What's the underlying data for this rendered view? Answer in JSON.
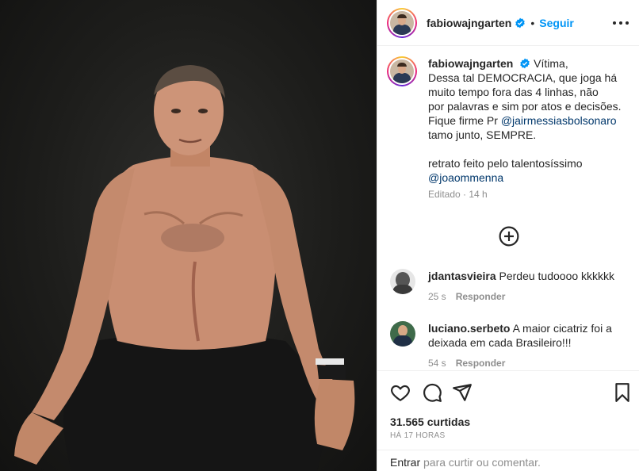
{
  "post": {
    "author": "fabiowajngarten",
    "follow_label": "Seguir",
    "dot": "•",
    "caption_lines": [
      "Vítima,",
      "Dessa tal DEMOCRACIA, que joga há",
      "muito tempo fora das 4 linhas, não",
      "por palavras e sim por atos e decisões.",
      "Fique firme Pr ",
      "tamo junto, SEMPRE.",
      "retrato feito pelo talentosíssimo"
    ],
    "mention_1": "@jairmessiasbolsonaro",
    "mention_2": "@joaommenna",
    "caption_meta": "Editado · 14 h"
  },
  "comments": [
    {
      "user": "jdantasvieira",
      "text": "Perdeu tudoooo kkkkkk",
      "time": "25 s",
      "reply": "Responder"
    },
    {
      "user": "luciano.serbeto",
      "text_line1": "A maior cicatriz foi a",
      "text_line2": "deixada em cada Brasileiro!!!",
      "time": "54 s",
      "reply": "Responder"
    }
  ],
  "actions": {
    "likes": "31.565 curtidas",
    "when": "HÁ 17 HORAS"
  },
  "footer": {
    "login_label": "Entrar",
    "rest": " para curtir ou comentar."
  },
  "icons": {
    "more": "more-options-icon",
    "verified": "verified-badge-icon",
    "load_more": "plus-circle-icon",
    "like": "heart-icon",
    "comment": "comment-icon",
    "share": "send-icon",
    "save": "bookmark-icon"
  },
  "colors": {
    "link": "#0095f6",
    "mention": "#00376b",
    "muted": "#8e8e8e",
    "verified": "#0095f6"
  }
}
